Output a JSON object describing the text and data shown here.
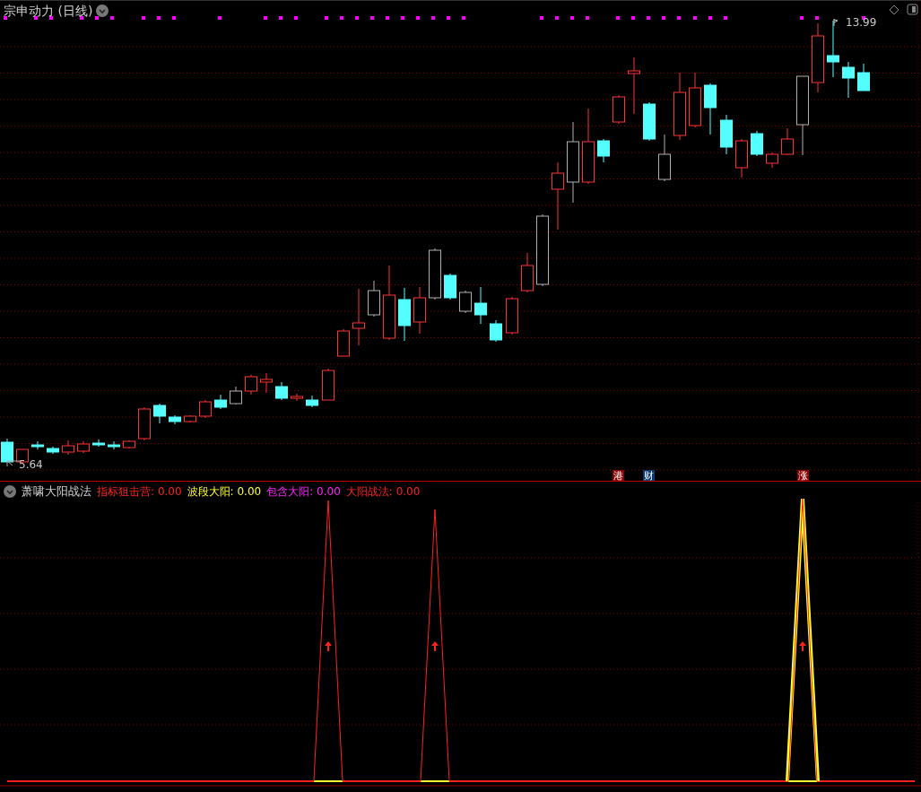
{
  "price_pane": {
    "title": "宗申动力 (日线)",
    "high_label": "13.99",
    "low_label": "5.64",
    "badges": [
      {
        "text": "港",
        "color": "#8b0000"
      },
      {
        "text": "财",
        "color": "#0b3a6e"
      },
      {
        "text": "涨",
        "color": "#8b0000"
      }
    ]
  },
  "indicator_pane": {
    "name": "萧啸大阳战法",
    "values": [
      {
        "label": "指标狙击营:",
        "value": "0.00",
        "color": "#ff2020"
      },
      {
        "label": "波段大阳:",
        "value": "0.00",
        "color": "#ffff33"
      },
      {
        "label": "包含大阳:",
        "value": "0.00",
        "color": "#ff22ff"
      },
      {
        "label": "大阳战法:",
        "value": "0.00",
        "color": "#ff2020"
      }
    ]
  }
}
